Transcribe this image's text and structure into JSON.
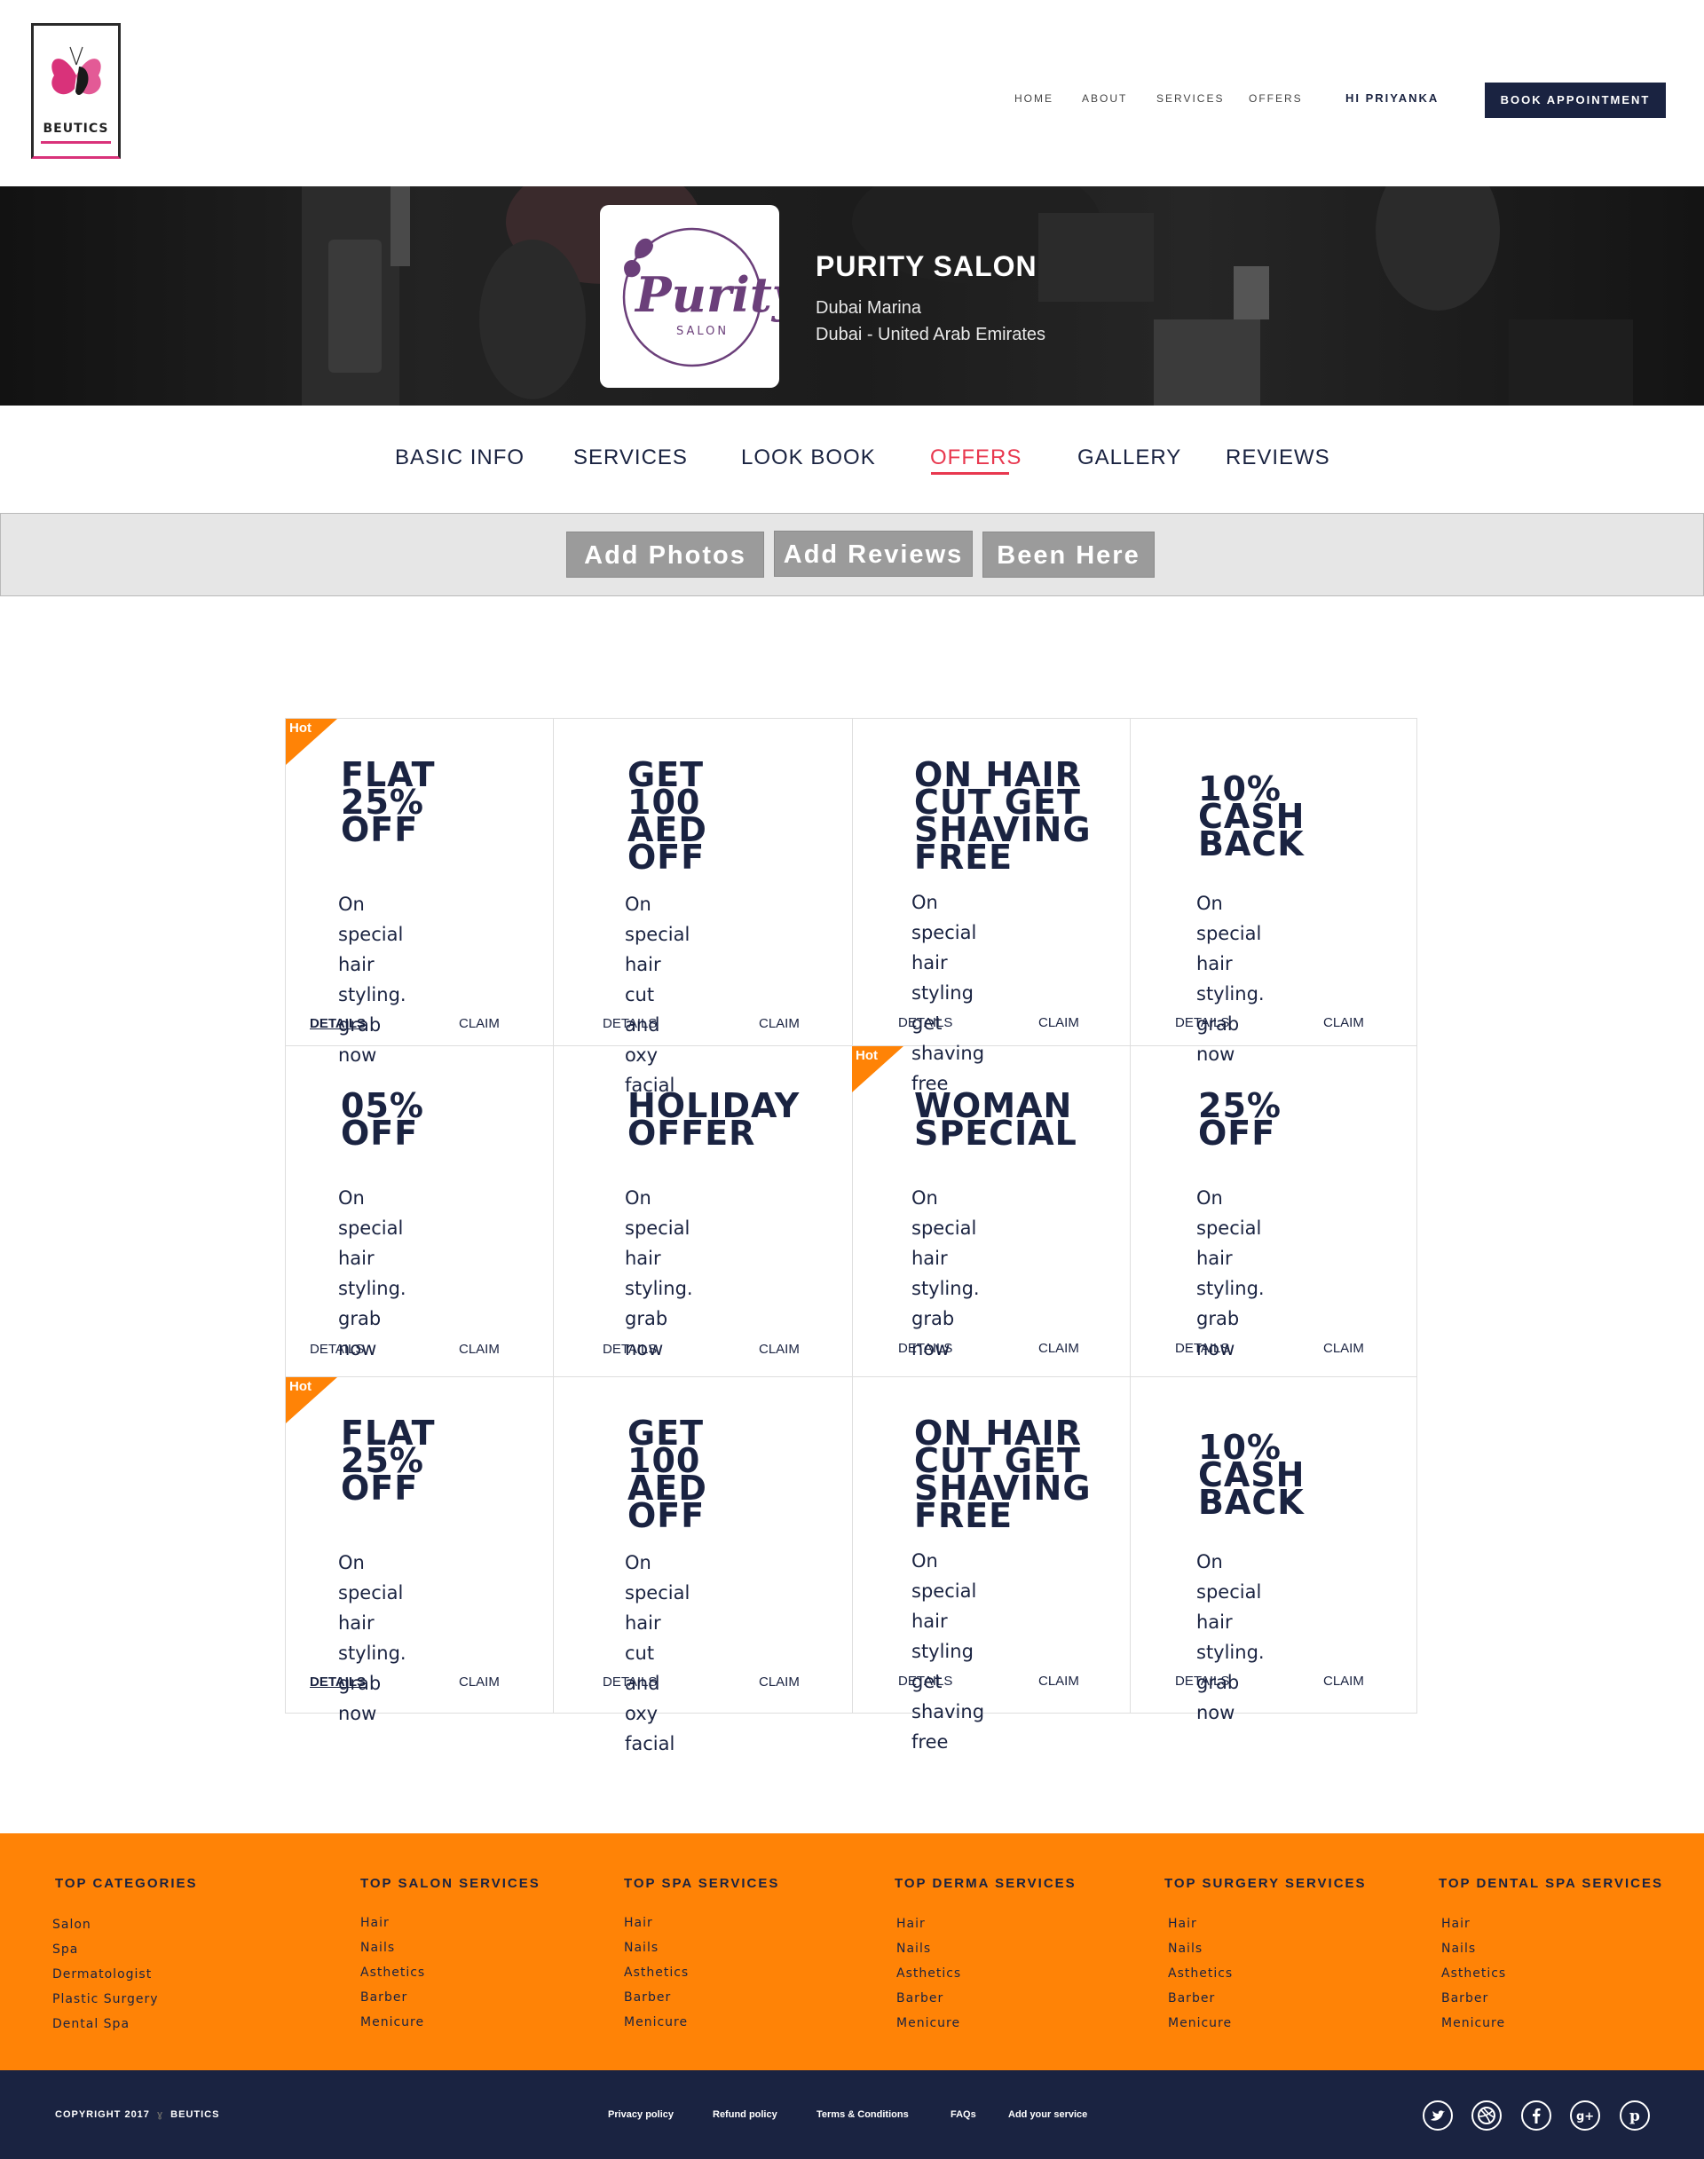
{
  "header": {
    "logo_text": "BEUTICS",
    "nav": [
      "HOME",
      "ABOUT",
      "SERVICES",
      "OFFERS"
    ],
    "greeting": "HI PRIYANKA",
    "book_button": "BOOK APPOINTMENT"
  },
  "salon": {
    "logo_word": "Purity",
    "logo_sub": "SALON",
    "name": "PURITY SALON",
    "location_line1": "Dubai Marina",
    "location_line2": "Dubai - United Arab Emirates"
  },
  "tabs": [
    "BASIC INFO",
    "SERVICES",
    "LOOK BOOK",
    "OFFERS",
    "GALLERY",
    "REVIEWS"
  ],
  "active_tab": "OFFERS",
  "actions": [
    "Add Photos",
    "Add Reviews",
    "Been Here"
  ],
  "offers": [
    {
      "title": "FLAT 25%\nOFF",
      "desc": "On special hair\nstyling. grab\nnow",
      "details": "DETAILS",
      "claim": "CLAIM",
      "hot": "Hot"
    },
    {
      "title": "GET\n100 AED\nOFF",
      "desc": "On special hair\ncut and oxy\nfacial",
      "details": "DETAILS",
      "claim": "CLAIM"
    },
    {
      "title": "ON HAIR\nCUT GET\nSHAVING\nFREE",
      "desc": "On special hair\nstyling get\nshaving free",
      "details": "DETAILS",
      "claim": "CLAIM"
    },
    {
      "title": "10%\nCASH\nBACK",
      "desc": "On special hair\nstyling. grab\nnow",
      "details": "DETAILS",
      "claim": "CLAIM"
    },
    {
      "title": "05%\nOFF",
      "desc": "On special hair\nstyling. grab\nnow",
      "details": "DETAILS",
      "claim": "CLAIM"
    },
    {
      "title": "HOLIDAY\nOFFER",
      "desc": "On special hair\nstyling. grab\nnow",
      "details": "DETAILS",
      "claim": "CLAIM"
    },
    {
      "title": "WOMAN\nSPECIAL",
      "desc": "On special hair\nstyling. grab\nnow",
      "details": "DETAILS",
      "claim": "CLAIM",
      "hot": "Hot"
    },
    {
      "title": "25%\nOFF",
      "desc": "On special hair\nstyling. grab\nnow",
      "details": "DETAILS",
      "claim": "CLAIM"
    },
    {
      "title": "FLAT 25%\nOFF",
      "desc": "On special hair\nstyling. grab\nnow",
      "details": "DETAILS",
      "claim": "CLAIM",
      "hot": "Hot"
    },
    {
      "title": "GET\n100 AED\nOFF",
      "desc": "On special hair\ncut and oxy\nfacial",
      "details": "DETAILS",
      "claim": "CLAIM"
    },
    {
      "title": "ON HAIR\nCUT GET\nSHAVING\nFREE",
      "desc": "On special hair\nstyling get\nshaving free",
      "details": "DETAILS",
      "claim": "CLAIM"
    },
    {
      "title": "10%\nCASH\nBACK",
      "desc": "On special hair\nstyling. grab\nnow",
      "details": "DETAILS",
      "claim": "CLAIM"
    }
  ],
  "footer": {
    "columns": [
      {
        "title": "TOP CATEGORIES",
        "links": [
          "Salon",
          "Spa",
          "Dermatologist",
          "Plastic Surgery",
          "Dental Spa"
        ]
      },
      {
        "title": "TOP SALON SERVICES",
        "links": [
          "Hair",
          "Nails",
          "Asthetics",
          "Barber",
          "Menicure"
        ]
      },
      {
        "title": "TOP SPA SERVICES",
        "links": [
          "Hair",
          "Nails",
          "Asthetics",
          "Barber",
          "Menicure"
        ]
      },
      {
        "title": "TOP DERMA SERVICES",
        "links": [
          "Hair",
          "Nails",
          "Asthetics",
          "Barber",
          "Menicure"
        ]
      },
      {
        "title": "TOP SURGERY SERVICES",
        "links": [
          "Hair",
          "Nails",
          "Asthetics",
          "Barber",
          "Menicure"
        ]
      },
      {
        "title": "TOP DENTAL SPA SERVICES",
        "links": [
          "Hair",
          "Nails",
          "Asthetics",
          "Barber",
          "Menicure"
        ]
      }
    ],
    "copyright": "COPYRIGHT 2017",
    "brand": "BEUTICS",
    "bottom_links": [
      "Privacy policy",
      "Refund policy",
      "Terms & Conditions",
      "FAQs",
      "Add your service"
    ],
    "social_icons": [
      "twitter-icon",
      "dribbble-icon",
      "facebook-icon",
      "google-plus-icon",
      "pinterest-icon"
    ]
  },
  "colors": {
    "navy": "#1a2341",
    "accent_red": "#e8384f",
    "footer_orange": "#ff8306",
    "hot_orange": "#ff8306",
    "button_grey": "#9b9b9b",
    "bar_grey": "#e6e6e6",
    "logo_pink": "#d9327a",
    "purity_purple": "#6b3f7a"
  }
}
